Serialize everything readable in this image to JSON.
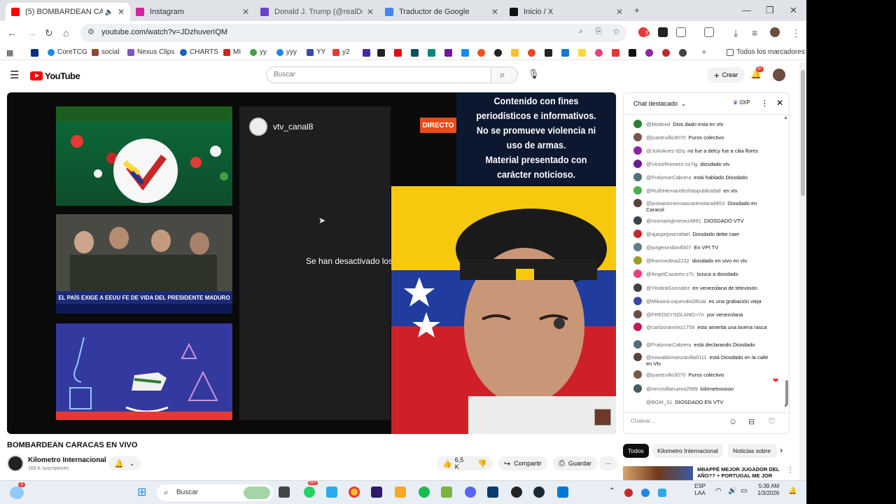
{
  "browser": {
    "tabs": [
      {
        "title": "(5) BOMBARDEAN CARACA",
        "color": "#ff0000",
        "active": true
      },
      {
        "title": "Instagram",
        "color": "#d6249f",
        "active": false
      },
      {
        "title": "Donald J. Trump (@realDonald",
        "color": "#6b3fd1",
        "active": false
      },
      {
        "title": "Traductor de Google",
        "color": "#4285f4",
        "active": false
      },
      {
        "title": "Inicio / X",
        "color": "#111111",
        "active": false
      }
    ],
    "url": "youtube.com/watch?v=JDzhuverIQM",
    "bookmarks": [
      "CoreTCG",
      "social",
      "Nexus Clips",
      "CHARTS",
      "MI",
      "yy",
      "yyy",
      "YY",
      "y2"
    ],
    "bookmarks_folder": "Todos los marcadores",
    "notif_badge": "5"
  },
  "youtube": {
    "logo_text": "YouTube",
    "search_placeholder": "Buscar",
    "create_label": "Crear",
    "notif_count": "9+"
  },
  "video": {
    "channel_overlay": "vtv_canal8",
    "live_badge": "DIRECTO",
    "chat_disabled": "Se han desactivado los",
    "disclaimer": [
      "Contenido con fines",
      "periodísticos e informativos.",
      "No se promueve violencia ni",
      "uso de armas.",
      "Material presentado con",
      "carácter noticioso."
    ],
    "thumb2_caption": "EL PAÍS EXIGE A EEUU FE DE VIDA DEL PRESIDENTE MADURO",
    "title": "BOMBARDEAN CARACAS EN VIVO",
    "channel_name": "Kilometro Internacional",
    "subscribers": "169 K suscriptores",
    "likes": "6,5 K",
    "share_label": "Compartir",
    "save_label": "Guardar"
  },
  "chat": {
    "header": "Chat destacado",
    "points": "0XP",
    "input_placeholder": "Chatear...",
    "messages": [
      {
        "author": "@Modoxd",
        "text": "Dios dado esta en vtv",
        "color": "#2e7d32"
      },
      {
        "author": "@juantruillo3070",
        "text": "Puros colectivo",
        "color": "#795548"
      },
      {
        "author": "@JulioAnez-d2q",
        "text": "no fue a delcy fue a cilia flores",
        "color": "#8e24aa"
      },
      {
        "author": "@VictorRomero-sz7ig",
        "text": "diosdado vtv",
        "color": "#6a1b9a"
      },
      {
        "author": "@FralymarCabrera",
        "text": "está hablado Diosdado",
        "color": "#546e7a"
      },
      {
        "author": "@RuthHernandezfotopublicidad",
        "text": "en vtv",
        "color": "#4caf50"
      },
      {
        "author": "@joseantoniomascarenolara9453",
        "text": "Diosdado en Caracol",
        "color": "#5d4037"
      },
      {
        "author": "@rosmarisjimenez4891",
        "text": "DIOSDADO VTV",
        "color": "#37474f"
      },
      {
        "author": "@ajaspejoserafael",
        "text": "Diosdado debe caer",
        "color": "#c62828"
      },
      {
        "author": "@jorgerondon4507",
        "text": "En VPI TV",
        "color": "#607d8b"
      },
      {
        "author": "@franmedina2232",
        "text": "diosdado en vivo en vtv",
        "color": "#9e9d24"
      },
      {
        "author": "@AngelCasares-z7c",
        "text": "busca a diosdado",
        "color": "#ec407a"
      },
      {
        "author": "@YindiraGonzalez",
        "text": "en venezolana de televisión",
        "color": "#424242"
      },
      {
        "author": "@MikamiLoquendoOficial",
        "text": "es una grabación vieja",
        "color": "#3949ab"
      },
      {
        "author": "@FREDDYSOLANO-r7n",
        "text": "por venezolana",
        "color": "#6d4c41"
      },
      {
        "author": "@carlosramirez1759",
        "text": "esto amerita una buena rasca",
        "color": "#c2185b"
      },
      {
        "author": "@FralymarCabrera",
        "text": "está declarando Diosdado",
        "color": "#546e7a"
      },
      {
        "author": "@oswaldomanzanilla6111",
        "text": "está Diosdado en la calle en Vtv",
        "color": "#5d4037"
      },
      {
        "author": "@juantruillo3070",
        "text": "Puros colectivo",
        "color": "#795548"
      },
      {
        "author": "@nervivillanueva2589",
        "text": "kilómetrooooo",
        "color": "#455a64"
      },
      {
        "author": "@BGM_31",
        "text": "DIOSDADO EN VTV",
        "color": "#ffffff"
      }
    ]
  },
  "chips": [
    "Todos",
    "Kilometro Internacional",
    "Noticias sobre"
  ],
  "recommendation": "MBAPPÉ MEJOR JUGADOR DEL AÑO?? + PORTUGAL ME JOR",
  "taskbar": {
    "search_placeholder": "Buscar",
    "badge_count": "99+",
    "time": "5:39 AM",
    "date": "1/3/2026",
    "lang": "ESP",
    "lang2": "LAA",
    "weather_badge": "3"
  }
}
